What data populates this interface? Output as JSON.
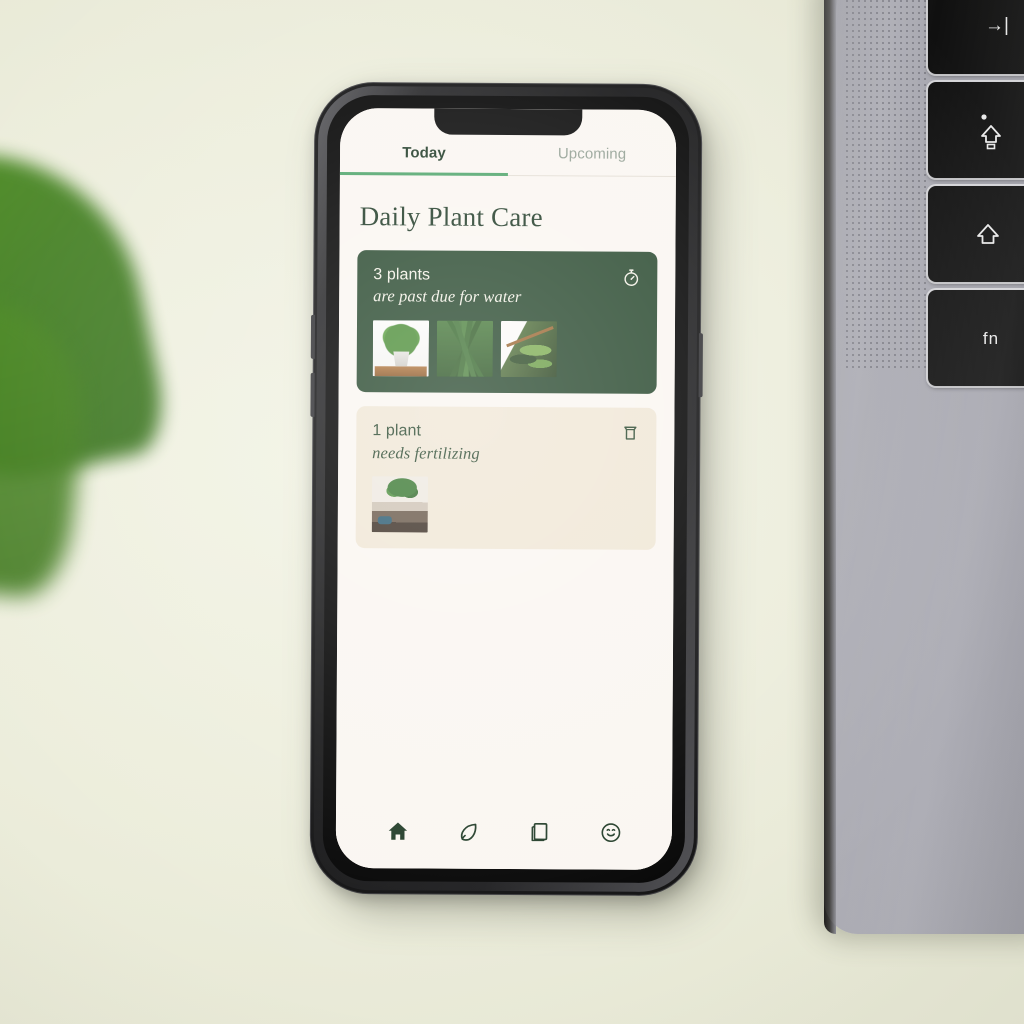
{
  "scene": {
    "background_color": "#EDEEDC",
    "leaf": {
      "name": "blurred-green-leaf",
      "color": "#41801D"
    },
    "laptop": {
      "name": "silver-laptop-keyboard",
      "body_color": "#A6A6AE",
      "keys": [
        {
          "name": "tab-key",
          "glyph": "→|"
        },
        {
          "name": "caps-lock-key",
          "glyph": "⇧"
        },
        {
          "name": "shift-key",
          "glyph": "⇧"
        },
        {
          "name": "fn-key",
          "glyph": "fn"
        }
      ]
    }
  },
  "phone": {
    "frame_color": "#0D0D0E",
    "screen_background": "#FAF6F1"
  },
  "app": {
    "accent_green": "#4FA56B",
    "dark_green": "#1F3A26",
    "tabs": [
      {
        "label": "Today",
        "active": true
      },
      {
        "label": "Upcoming",
        "active": false
      }
    ],
    "title": "Daily Plant Care",
    "cards": [
      {
        "count": "3 plants",
        "subtitle": "are past due for water",
        "icon": "stopwatch-icon",
        "background_color": "#2A4A30",
        "text_color": "#F3F1E6",
        "thumbnails": [
          "potted-bushy-plant",
          "aloe-vera-plant",
          "striped-leaf-plant"
        ]
      },
      {
        "count": "1 plant",
        "subtitle": "needs fertilizing",
        "icon": "fertilizer-jar-icon",
        "background_color": "#F0E7D6",
        "text_color": "#2C4A31",
        "thumbnails": [
          "indoor-room-plant"
        ]
      }
    ],
    "nav": [
      {
        "name": "home",
        "icon": "home-icon",
        "active": true
      },
      {
        "name": "plants",
        "icon": "leaf-icon",
        "active": false
      },
      {
        "name": "library",
        "icon": "book-icon",
        "active": false
      },
      {
        "name": "profile",
        "icon": "smiley-face-icon",
        "active": false
      }
    ]
  }
}
